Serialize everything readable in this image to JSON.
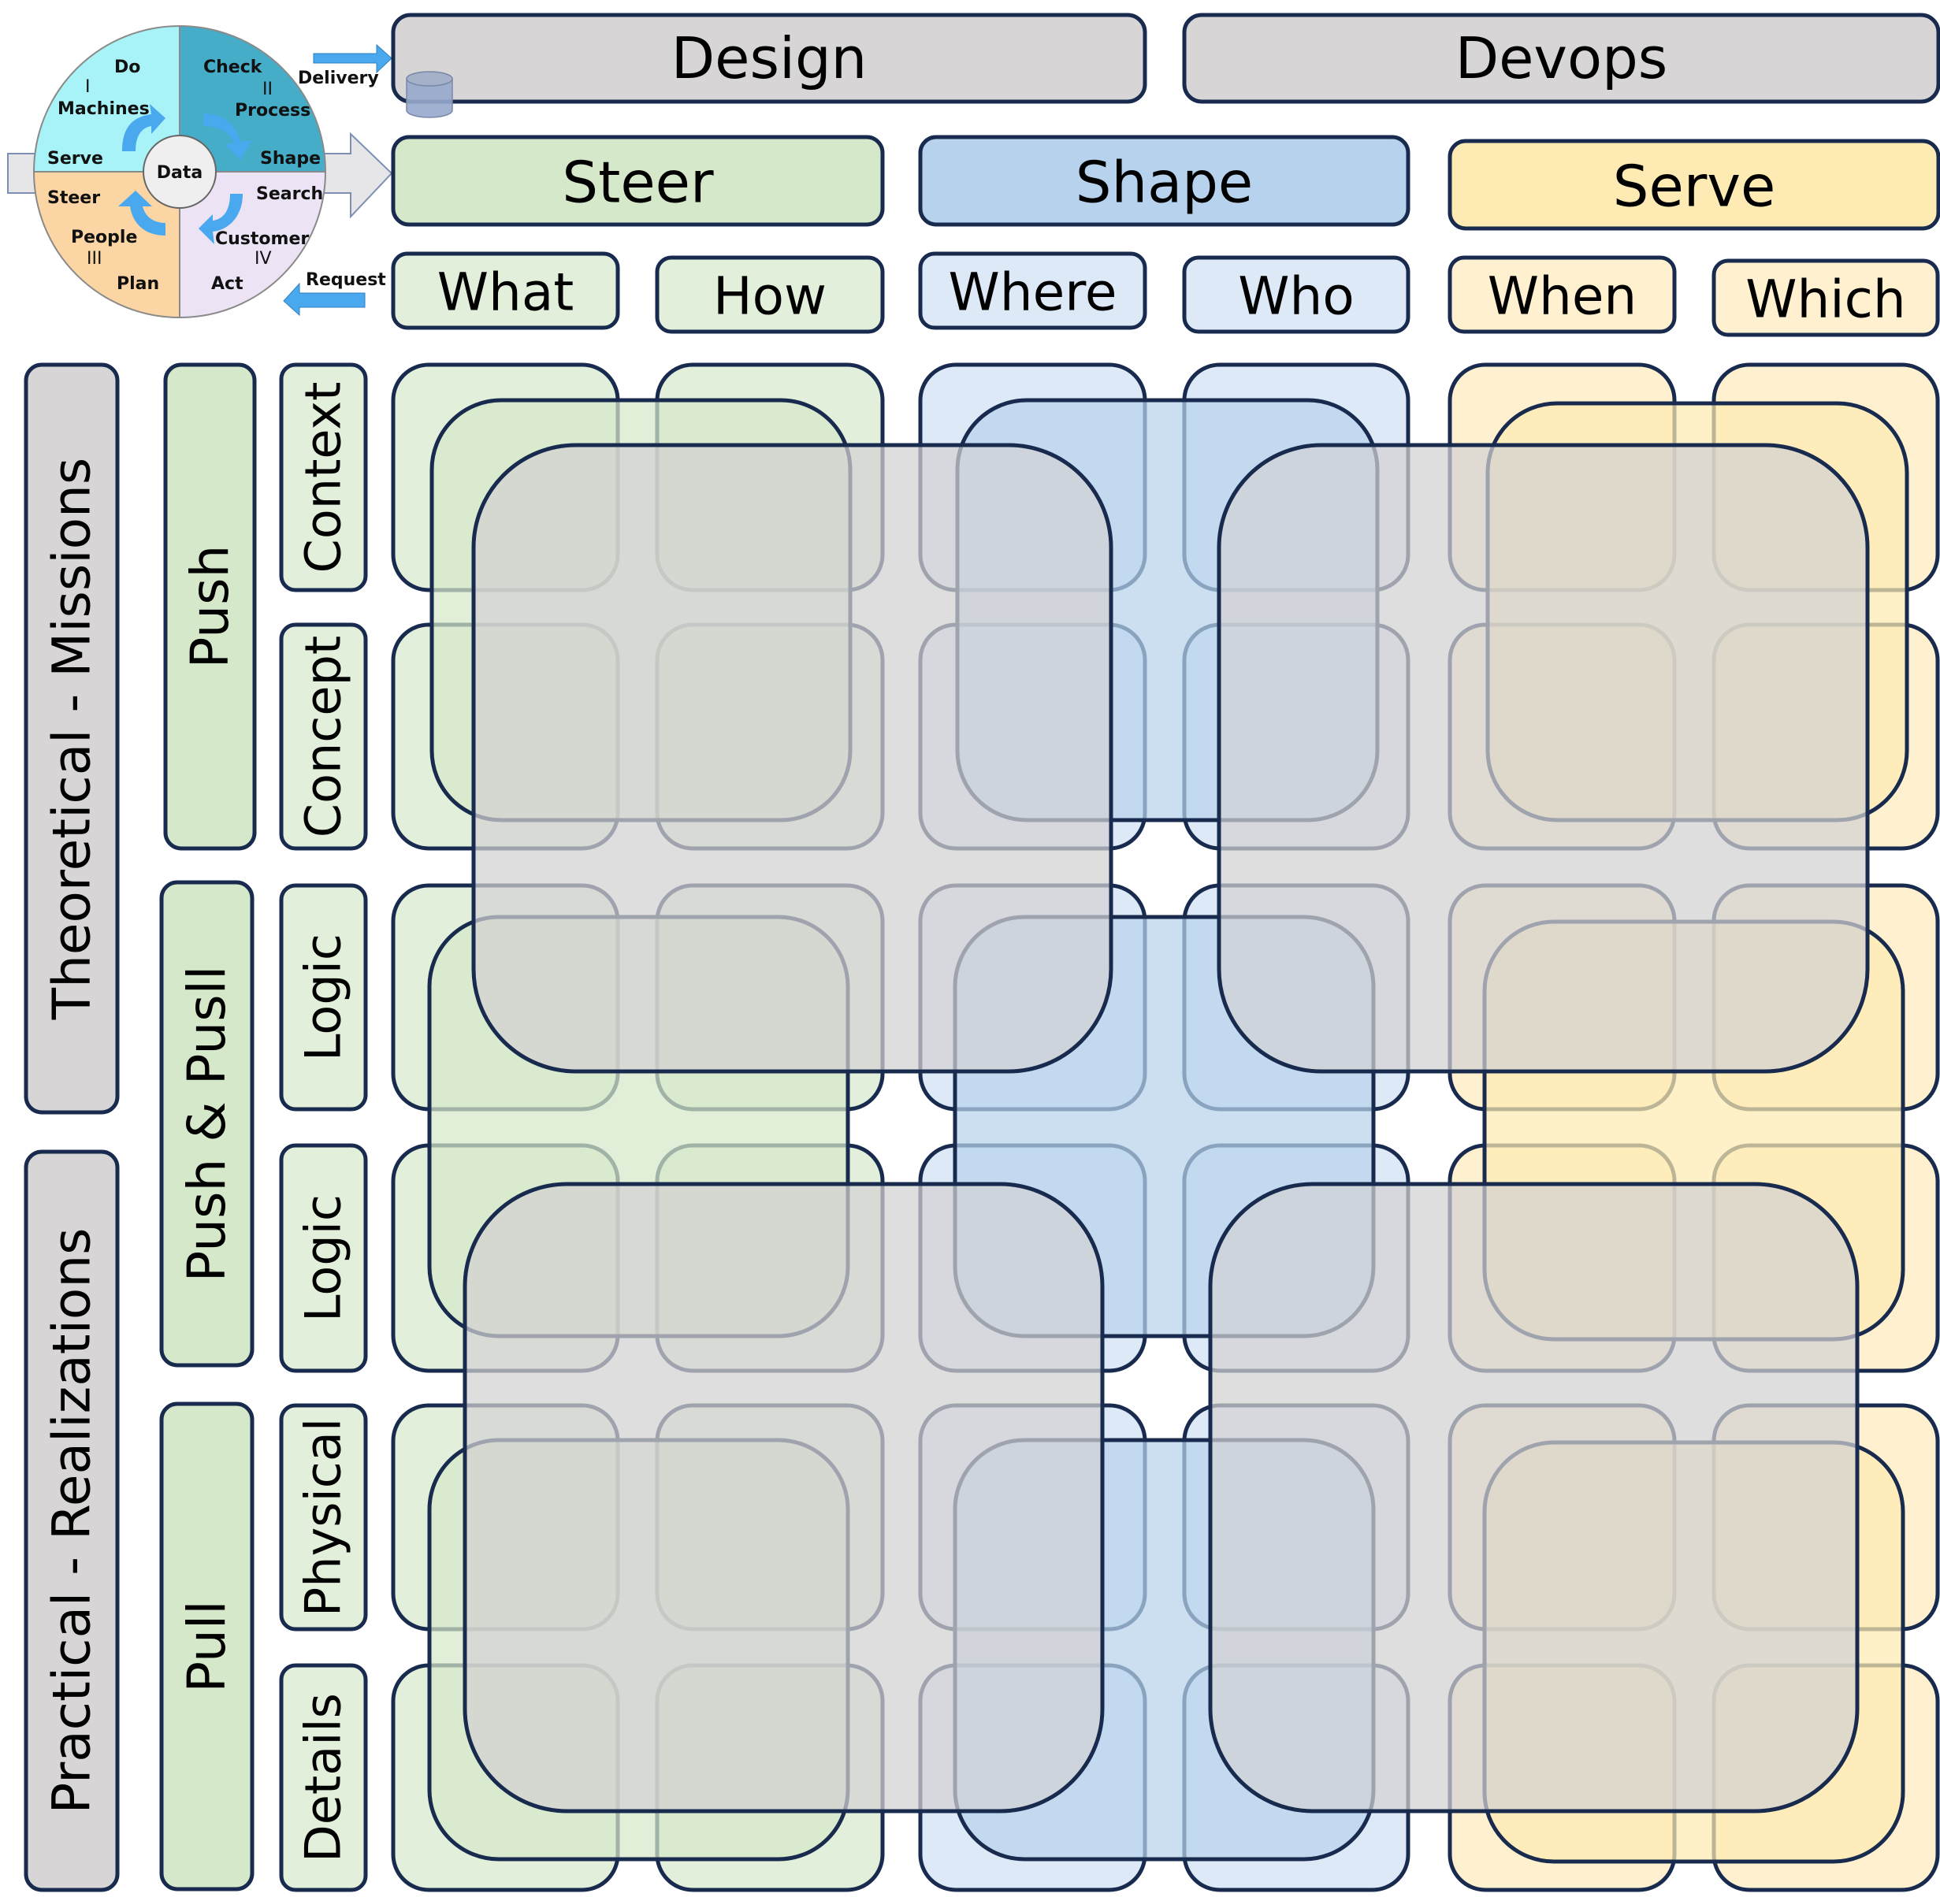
{
  "cycle_diagram": {
    "center_label": "Data",
    "quadrants": [
      {
        "name": "Do",
        "numeral": "I",
        "subject": "Machines",
        "corner_label": "Serve",
        "color": "#a8f3f7"
      },
      {
        "name": "Check",
        "numeral": "II",
        "subject": "Process",
        "corner_label": "Shape",
        "color": "#45adc8"
      },
      {
        "name": "Act",
        "numeral": "IV",
        "subject": "Customer",
        "corner_label": "Search",
        "color": "#ece3f4"
      },
      {
        "name": "Plan",
        "numeral": "III",
        "subject": "People",
        "corner_label": "Steer",
        "color": "#fbd5a3"
      }
    ],
    "arrows": {
      "delivery": "Delivery",
      "request": "Request"
    },
    "arrow_color": "#4aa8ee"
  },
  "header": {
    "top": [
      {
        "id": "design",
        "label": "Design"
      },
      {
        "id": "devops",
        "label": "Devops"
      }
    ],
    "groups": [
      {
        "id": "steer",
        "label": "Steer",
        "color": "#d5e8c9",
        "light": "#e2efda"
      },
      {
        "id": "shape",
        "label": "Shape",
        "color": "#b7d2ec",
        "light": "#dde9f6"
      },
      {
        "id": "serve",
        "label": "Serve",
        "color": "#feebb3",
        "light": "#fff1cf"
      }
    ],
    "columns": [
      {
        "label": "What",
        "group": "steer"
      },
      {
        "label": "How",
        "group": "steer"
      },
      {
        "label": "Where",
        "group": "shape"
      },
      {
        "label": "Who",
        "group": "shape"
      },
      {
        "label": "When",
        "group": "serve"
      },
      {
        "label": "Which",
        "group": "serve"
      }
    ]
  },
  "side": {
    "perspectives": [
      {
        "label": "Theoretical - Missions"
      },
      {
        "label": "Practical - Realizations"
      }
    ],
    "flows": [
      {
        "label": "Push"
      },
      {
        "label": "Push & Pusll"
      },
      {
        "label": "Pull"
      }
    ],
    "rows": [
      {
        "label": "Context"
      },
      {
        "label": "Concept"
      },
      {
        "label": "Logic"
      },
      {
        "label": "Logic"
      },
      {
        "label": "Physical"
      },
      {
        "label": "Details"
      }
    ]
  },
  "colors": {
    "border": "#182b4e",
    "neutral": "#d7d5d6",
    "overlay_grey": "#d2d1d3"
  }
}
